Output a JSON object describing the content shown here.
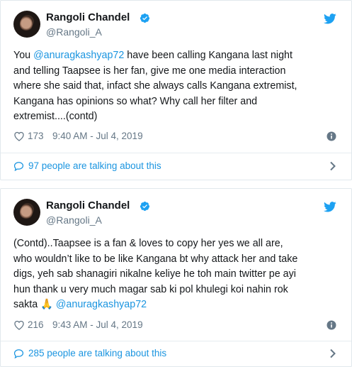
{
  "colors": {
    "accent": "#1b95e0",
    "muted": "#657786",
    "text": "#14171a",
    "border": "#e1e8ed"
  },
  "tweets": [
    {
      "display_name": "Rangoli Chandel",
      "handle": "@Rangoli_A",
      "lines": [
        [
          "You ",
          "@anuragkashyap72",
          " have been calling Kangana last  night"
        ],
        [
          "and telling Taapsee is her fan, give me one media interaction",
          "",
          ""
        ],
        [
          "where she said that, infact she always calls Kangana extremist,",
          "",
          ""
        ],
        [
          "Kangana has opinions so what? Why call her filter and",
          "",
          ""
        ],
        [
          "extremist....(contd)",
          "",
          ""
        ]
      ],
      "likes": "173",
      "timestamp": "9:40 AM - Jul 4, 2019",
      "talking": "97 people are talking about this"
    },
    {
      "display_name": "Rangoli Chandel",
      "handle": "@Rangoli_A",
      "lines": [
        [
          "(Contd)..Taapsee is a fan & loves to copy her yes we all are,",
          "",
          ""
        ],
        [
          "who wouldn’t like to be like Kangana bt why attack her and take",
          "",
          ""
        ],
        [
          "digs, yeh sab shanagiri nikalne keliye he toh main twitter pe ayi",
          "",
          ""
        ],
        [
          "hun thank u very much magar sab ki pol khulegi koi nahin rok",
          "",
          ""
        ],
        [
          "sakta 🙏 ",
          "@anuragkashyap72",
          ""
        ]
      ],
      "likes": "216",
      "timestamp": "9:43 AM - Jul 4, 2019",
      "talking": "285 people are talking about this"
    }
  ],
  "icons": {
    "verified": "verified-badge-icon",
    "twitter": "twitter-bird-icon",
    "like": "heart-icon",
    "info": "info-icon",
    "reply": "speech-bubble-icon",
    "chevron": "chevron-right-icon"
  }
}
